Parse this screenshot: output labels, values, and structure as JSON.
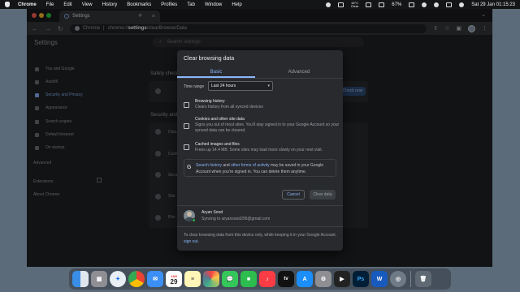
{
  "menubar": {
    "app": "Chrome",
    "items": [
      "File",
      "Edit",
      "View",
      "History",
      "Bookmarks",
      "Profiles",
      "Tab",
      "Window",
      "Help"
    ],
    "weather_temp": "16°C",
    "weather_desc": "Clear",
    "battery": "67%",
    "datetime": "Sat 29 Jan  01:15:23"
  },
  "browser": {
    "tab_title": "Settings",
    "new_tab_symbol": "+",
    "close_symbol": "×",
    "url_prefix": "Chrome",
    "url_scheme": "chrome://",
    "url_bold": "settings",
    "url_path": "/clearBrowserData"
  },
  "settings": {
    "title": "Settings",
    "search_placeholder": "Search settings",
    "nav": [
      {
        "label": "You and Google"
      },
      {
        "label": "Autofill"
      },
      {
        "label": "Security and Privacy",
        "active": true
      },
      {
        "label": "Appearance"
      },
      {
        "label": "Search engine"
      },
      {
        "label": "Default browser"
      },
      {
        "label": "On startup"
      }
    ],
    "advanced": "Advanced",
    "extensions": "Extensions",
    "about": "About Chrome",
    "safety_check": "Safety check",
    "check_now": "Check now",
    "privacy_section": "Security and priv",
    "rows": [
      "Clea",
      "Cook",
      "Secu",
      "Site",
      "Priv"
    ]
  },
  "dialog": {
    "title": "Clear browsing data",
    "tabs": [
      "Basic",
      "Advanced"
    ],
    "time_range_label": "Time range",
    "time_range_value": "Last 24 hours",
    "options": [
      {
        "title": "Browsing history",
        "desc": "Clears history from all synced devices",
        "checked": false
      },
      {
        "title": "Cookies and other site data",
        "desc": "Signs you out of most sites. You'll stay signed in to your Google Account so your synced data can be cleared.",
        "checked": false
      },
      {
        "title": "Cached images and files",
        "desc": "Frees up 14.4 MB. Some sites may load more slowly on your next visit.",
        "checked": false
      }
    ],
    "google_note": {
      "link1": "Search history",
      "mid1": " and ",
      "link2": "other forms of activity",
      "rest": " may be saved in your Google Account when you're signed in. You can delete them anytime."
    },
    "cancel": "Cancel",
    "clear": "Clear data",
    "profile_name": "Aryan Sood",
    "profile_sync": "Syncing to aryansood295@gmail.com",
    "footer_text": "To clear browsing data from this device only, while keeping it in your Google Account, ",
    "footer_link": "sign out."
  },
  "dock": {
    "calendar_month": "JAN",
    "calendar_day": "29",
    "apps": [
      "finder",
      "launchpad",
      "safari",
      "chrome",
      "mail",
      "calendar",
      "notes",
      "photos",
      "messages",
      "facetime",
      "music",
      "appletv",
      "appstore",
      "settings",
      "finalcut",
      "photoshop",
      "word",
      "screenshot",
      "trash"
    ]
  },
  "colors": {
    "accent": "#8ab4f8",
    "dialog_bg": "#292a2d",
    "page_bg": "#202124"
  }
}
